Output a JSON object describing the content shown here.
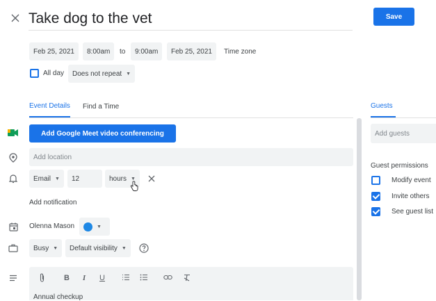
{
  "event": {
    "title": "Take dog to the vet",
    "save_label": "Save"
  },
  "datetime": {
    "start_date": "Feb 25, 2021",
    "start_time": "8:00am",
    "to_label": "to",
    "end_time": "9:00am",
    "end_date": "Feb 25, 2021",
    "timezone_label": "Time zone",
    "allday_label": "All day",
    "repeat_label": "Does not repeat"
  },
  "tabs": {
    "details": "Event Details",
    "find_time": "Find a Time"
  },
  "meet": {
    "label": "Add Google Meet video conferencing"
  },
  "location": {
    "placeholder": "Add location"
  },
  "notification": {
    "method": "Email",
    "amount": "12",
    "unit": "hours",
    "add_label": "Add notification"
  },
  "calendar": {
    "owner": "Olenna Mason",
    "color": "#1e88e5"
  },
  "availability": {
    "status": "Busy",
    "visibility": "Default visibility"
  },
  "description": {
    "text": "Annual checkup"
  },
  "guests": {
    "tab_label": "Guests",
    "add_placeholder": "Add guests",
    "permissions_title": "Guest permissions",
    "permissions": [
      {
        "label": "Modify event",
        "checked": false
      },
      {
        "label": "Invite others",
        "checked": true
      },
      {
        "label": "See guest list",
        "checked": true
      }
    ]
  },
  "colors": {
    "accent": "#1a73e8",
    "meet_green": "#0f9d58",
    "meet_yellow": "#f4b400"
  }
}
